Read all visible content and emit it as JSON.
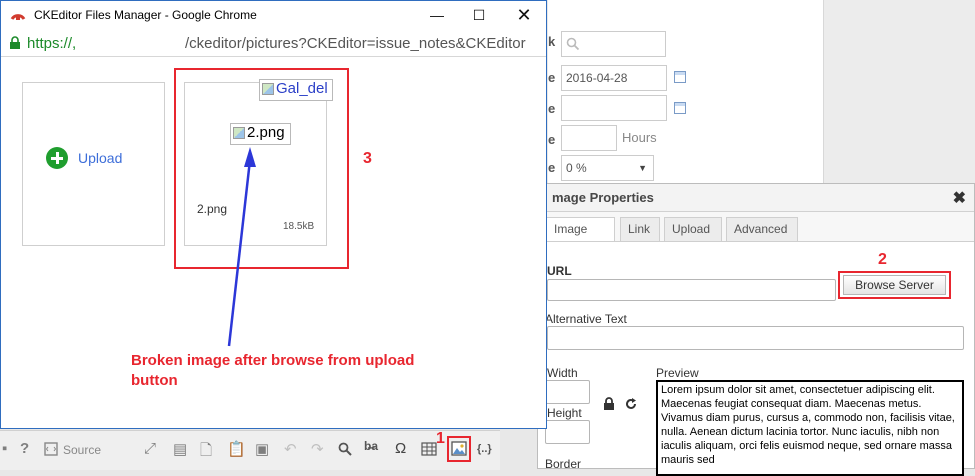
{
  "background_form": {
    "search_icon": "magnifier-icon",
    "date_value": "2016-04-28",
    "hours_label": "Hours",
    "percent_value": "0 %",
    "label_fragments": [
      "k",
      "e",
      "e",
      "e",
      "e"
    ]
  },
  "dialog": {
    "title": "mage Properties",
    "close_label": "✖",
    "tabs": [
      {
        "label": "Image Info",
        "active": true
      },
      {
        "label": "Link",
        "active": false
      },
      {
        "label": "Upload",
        "active": false
      },
      {
        "label": "Advanced",
        "active": false
      }
    ],
    "url_label": "URL",
    "url_value": "",
    "browse_button": "Browse Server",
    "alt_label": "Alternative Text",
    "width_label": "Width",
    "height_label": "Height",
    "border_label": "Border",
    "preview_label": "Preview",
    "preview_text": "Lorem ipsum dolor sit amet, consectetuer adipiscing elit. Maecenas feugiat consequat diam. Maecenas metus. Vivamus diam purus, cursus a, commodo non, facilisis vitae, nulla. Aenean dictum lacinia tortor. Nunc iaculis, nibh non iaculis aliquam, orci felis euismod neque, sed ornare massa mauris sed"
  },
  "popup": {
    "window_title": "CKEditor Files Manager - Google Chrome",
    "url_scheme": "https://,",
    "url_path": "/ckeditor/pictures?CKEditor=issue_notes&CKEditor",
    "upload_label": "Upload",
    "file_alt_delete": "Gal_del",
    "file_alt_image": "2.png",
    "file_name": "2.png",
    "file_size": "18.5kB"
  },
  "annotations": {
    "step1": "1",
    "step2": "2",
    "step3": "3",
    "note": "Broken image after browse from upload button",
    "colors": {
      "red": "#e8262f",
      "blue": "#2c37d8"
    }
  },
  "toolbar": {
    "source_label": "Source",
    "items": [
      "help-icon",
      "source-icon",
      "maximize-icon",
      "templates-icon",
      "paste-icon",
      "paste-text-icon",
      "paste-word-icon",
      "undo-icon",
      "redo-icon",
      "find-icon",
      "replace-icon",
      "special-char-icon",
      "table-icon",
      "image-icon",
      "code-snippet-icon"
    ]
  }
}
